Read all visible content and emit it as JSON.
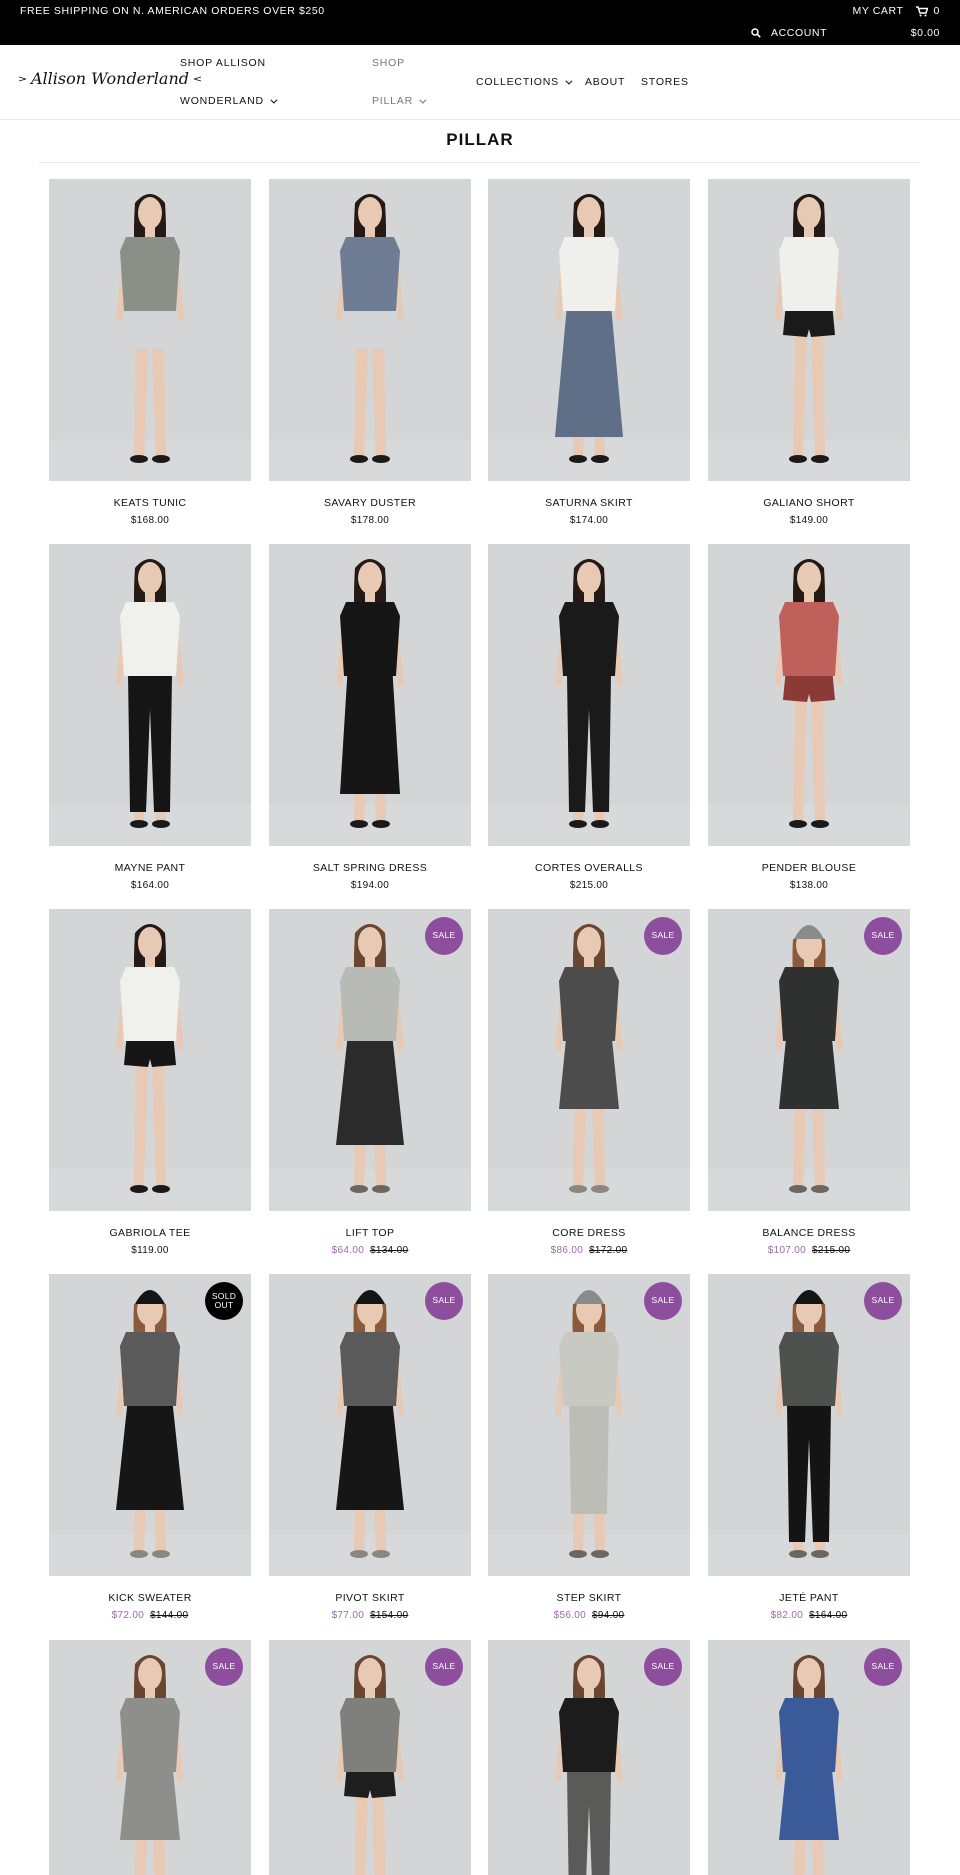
{
  "announcement": {
    "shipping": "FREE SHIPPING ON N. AMERICAN ORDERS OVER $250",
    "cart_label": "MY CART",
    "cart_count": "0",
    "account_label": "ACCOUNT",
    "cart_total": "$0.00"
  },
  "header": {
    "logo_text": "Allison Wonderland",
    "nav": {
      "shop_allison_line1": "SHOP ALLISON",
      "shop_allison_line2": "WONDERLAND",
      "shop_line1": "SHOP",
      "shop_line2": "PILLAR",
      "collections": "COLLECTIONS",
      "about": "ABOUT",
      "stores": "STORES"
    }
  },
  "page": {
    "title": "PILLAR"
  },
  "products": [
    {
      "name": "KEATS TUNIC",
      "price": "$168.00",
      "sale_price": "",
      "old_price": "",
      "badge": "",
      "top": "#8a9088",
      "bottom": "#8a9088",
      "legs": "skin",
      "hair": "dark",
      "shoes": "#1a1a1a"
    },
    {
      "name": "SAVARY DUSTER",
      "price": "$178.00",
      "sale_price": "",
      "old_price": "",
      "badge": "",
      "top": "#6e7d93",
      "bottom": "#1c1c1c",
      "legs": "skin",
      "hair": "dark",
      "shoes": "#1a1a1a"
    },
    {
      "name": "SATURNA SKIRT",
      "price": "$174.00",
      "sale_price": "",
      "old_price": "",
      "badge": "",
      "top": "#efefeb",
      "bottom": "#5f6f88",
      "legs": "skirt",
      "hair": "dark",
      "shoes": "#1a1a1a"
    },
    {
      "name": "GALIANO SHORT",
      "price": "$149.00",
      "sale_price": "",
      "old_price": "",
      "badge": "",
      "top": "#efefeb",
      "bottom": "#1a1a1a",
      "legs": "shorts",
      "hair": "dark",
      "shoes": "#1a1a1a"
    },
    {
      "name": "MAYNE PANT",
      "price": "$164.00",
      "sale_price": "",
      "old_price": "",
      "badge": "",
      "top": "#f0f0ec",
      "bottom": "#151515",
      "legs": "pants",
      "hair": "dark",
      "shoes": "#1a1a1a"
    },
    {
      "name": "SALT SPRING DRESS",
      "price": "$194.00",
      "sale_price": "",
      "old_price": "",
      "badge": "",
      "top": "#161616",
      "bottom": "#161616",
      "legs": "longdress",
      "hair": "dark",
      "shoes": "#1a1a1a"
    },
    {
      "name": "CORTES OVERALLS",
      "price": "$215.00",
      "sale_price": "",
      "old_price": "",
      "badge": "",
      "top": "#1a1a1a",
      "bottom": "#1a1a1a",
      "legs": "pants",
      "hair": "dark",
      "shoes": "#1a1a1a"
    },
    {
      "name": "PENDER BLOUSE",
      "price": "$138.00",
      "sale_price": "",
      "old_price": "",
      "badge": "",
      "top": "#c0605a",
      "bottom": "#8c3a36",
      "legs": "shorts",
      "hair": "dark",
      "shoes": "#1a1a1a"
    },
    {
      "name": "GABRIOLA TEE",
      "price": "$119.00",
      "sale_price": "",
      "old_price": "",
      "badge": "",
      "top": "#f0f0ec",
      "bottom": "#161616",
      "legs": "shorts",
      "hair": "dark",
      "shoes": "#1a1a1a"
    },
    {
      "name": "LIFT TOP",
      "price": "",
      "sale_price": "$64.00",
      "old_price": "$134.00",
      "badge": "SALE",
      "top": "#b8bab6",
      "bottom": "#2b2b2b",
      "legs": "culotte",
      "hair": "brown",
      "shoes": "#6b6660"
    },
    {
      "name": "CORE DRESS",
      "price": "",
      "sale_price": "$86.00",
      "old_price": "$172.00",
      "badge": "SALE",
      "top": "#4c4c4c",
      "bottom": "#4c4c4c",
      "legs": "dress",
      "hair": "brown",
      "shoes": "#8a8680"
    },
    {
      "name": "BALANCE DRESS",
      "price": "",
      "sale_price": "$107.00",
      "old_price": "$215.00",
      "badge": "SALE",
      "top": "#2f3030",
      "bottom": "#2f3030",
      "legs": "dress",
      "hair": "beanie-grey",
      "shoes": "#6b6660"
    },
    {
      "name": "KICK SWEATER",
      "price": "",
      "sale_price": "$72.00",
      "old_price": "$144.00",
      "badge": "SOLD OUT",
      "top": "#5a5a5a",
      "bottom": "#161616",
      "legs": "culotte",
      "hair": "beanie-black",
      "shoes": "#8a8680"
    },
    {
      "name": "PIVOT SKIRT",
      "price": "",
      "sale_price": "$77.00",
      "old_price": "$154.00",
      "badge": "SALE",
      "top": "#5a5a5a",
      "bottom": "#161616",
      "legs": "culotte",
      "hair": "beanie-black",
      "shoes": "#8a8680"
    },
    {
      "name": "STEP SKIRT",
      "price": "",
      "sale_price": "$56.00",
      "old_price": "$94.00",
      "badge": "SALE",
      "top": "#c9c9c4",
      "bottom": "#bdbdb8",
      "legs": "pencil",
      "hair": "beanie-grey",
      "shoes": "#6b6660"
    },
    {
      "name": "JETÉ PANT",
      "price": "",
      "sale_price": "$82.00",
      "old_price": "$164.00",
      "badge": "SALE",
      "top": "#4e524e",
      "bottom": "#141414",
      "legs": "pants",
      "hair": "beanie-black",
      "shoes": "#6b6660"
    },
    {
      "name": "",
      "price": "",
      "sale_price": "",
      "old_price": "",
      "badge": "SALE",
      "top": "#8e8e8a",
      "bottom": "#8e8e8a",
      "legs": "dress",
      "hair": "brown",
      "shoes": "#6b6660"
    },
    {
      "name": "",
      "price": "",
      "sale_price": "",
      "old_price": "",
      "badge": "SALE",
      "top": "#7f7f7b",
      "bottom": "#1e1e1e",
      "legs": "shorts",
      "hair": "brown",
      "shoes": "#6b6660"
    },
    {
      "name": "",
      "price": "",
      "sale_price": "",
      "old_price": "",
      "badge": "SALE",
      "top": "#1c1c1c",
      "bottom": "#5a5a58",
      "legs": "pants",
      "hair": "brown",
      "shoes": "#6b6660"
    },
    {
      "name": "",
      "price": "",
      "sale_price": "",
      "old_price": "",
      "badge": "SALE",
      "top": "#3a5a9a",
      "bottom": "#3a5a9a",
      "legs": "dress",
      "hair": "brown",
      "shoes": "#6b6660"
    }
  ],
  "colors": {
    "sale_badge": "#8e4e9e",
    "sale_price": "#9b6aa6",
    "soldout_badge": "#000000",
    "photo_bg": "#d4d5d7"
  }
}
